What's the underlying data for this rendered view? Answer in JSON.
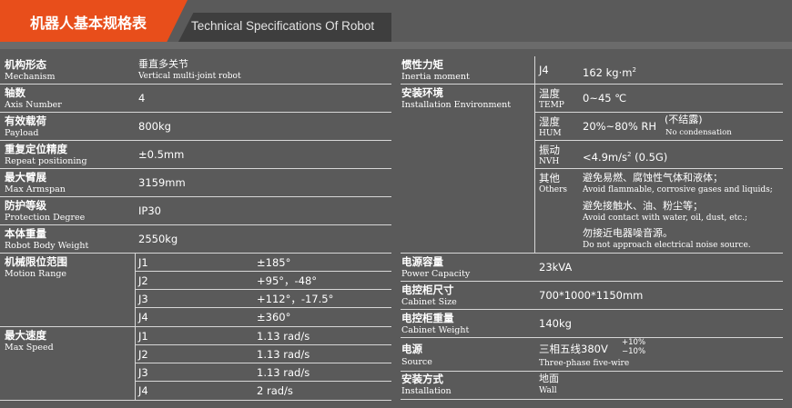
{
  "header": {
    "title_cn": "机器人基本规格表",
    "title_en": "Technical Specifications Of Robot"
  },
  "left": {
    "rows": [
      {
        "cn": "机构形态",
        "en": "Mechanism",
        "val": "垂直多关节",
        "val_en": "Vertical multi-joint robot"
      },
      {
        "cn": "轴数",
        "en": "Axis Number",
        "val": "4"
      },
      {
        "cn": "有效载荷",
        "en": "Payload",
        "val": "800kg"
      },
      {
        "cn": "重复定位精度",
        "en": "Repeat positioning",
        "val": "±0.5mm"
      },
      {
        "cn": "最大臂展",
        "en": "Max Armspan",
        "val": "3159mm"
      },
      {
        "cn": "防护等级",
        "en": "Protection Degree",
        "val": "IP30"
      },
      {
        "cn": "本体重量",
        "en": "Robot Body Weight",
        "val": "2550kg"
      }
    ],
    "motion_range": {
      "cn": "机械限位范围",
      "en": "Motion Range",
      "joints": [
        {
          "j": "J1",
          "v": "±185°"
        },
        {
          "j": "J2",
          "v": "+95°，-48°"
        },
        {
          "j": "J3",
          "v": "+112°，-17.5°"
        },
        {
          "j": "J4",
          "v": "±360°"
        }
      ]
    },
    "max_speed": {
      "cn": "最大速度",
      "en": "Max Speed",
      "joints": [
        {
          "j": "J1",
          "v": "1.13 rad/s"
        },
        {
          "j": "J2",
          "v": "1.13 rad/s"
        },
        {
          "j": "J3",
          "v": "1.13 rad/s"
        },
        {
          "j": "J4",
          "v": "2 rad/s"
        }
      ]
    }
  },
  "right": {
    "inertia": {
      "cn": "惯性力矩",
      "en": "Inertia moment",
      "sub": "J4",
      "val": "162 kg·m",
      "val_sup": "2"
    },
    "env": {
      "cn": "安装环境",
      "en": "Installation Environment",
      "temp": {
        "cn": "温度",
        "en": "TEMP",
        "val": "0~45 ℃"
      },
      "hum": {
        "cn": "湿度",
        "en": "HUM",
        "val": "20%~80% RH",
        "note_cn": "(不结露)",
        "note_en": "No condensation"
      },
      "vib": {
        "cn": "振动",
        "en": "NVH",
        "val": "<4.9m/s",
        "val_sup": "2",
        "val_tail": " (0.5G)"
      },
      "other": {
        "cn": "其他",
        "en": "Others",
        "lines": [
          {
            "cn": "避免易燃、腐蚀性气体和液体；",
            "en": "Avoid flammable, corrosive gases and liquids;"
          },
          {
            "cn": "避免接触水、油、粉尘等；",
            "en": "Avoid contact with water, oil, dust, etc.;"
          },
          {
            "cn": "勿接近电器噪音源。",
            "en": "Do not approach electrical noise source."
          }
        ]
      }
    },
    "capacity": {
      "cn": "电源容量",
      "en": "Power Capacity",
      "val": "23kVA"
    },
    "cabinet_size": {
      "cn": "电控柜尺寸",
      "en": "Cabinet Size",
      "val": "700*1000*1150mm"
    },
    "cabinet_weight": {
      "cn": "电控柜重量",
      "en": "Cabinet Weight",
      "val": "140kg"
    },
    "source": {
      "cn": "电源",
      "en": "Source",
      "val_cn": "三相五线380V",
      "tol_up": "+10%",
      "tol_down": "−10%",
      "val_en": "Three-phase five-wire"
    },
    "install": {
      "cn": "安装方式",
      "en": "Installation",
      "val_cn": "地面",
      "val_en": "Wall"
    }
  }
}
